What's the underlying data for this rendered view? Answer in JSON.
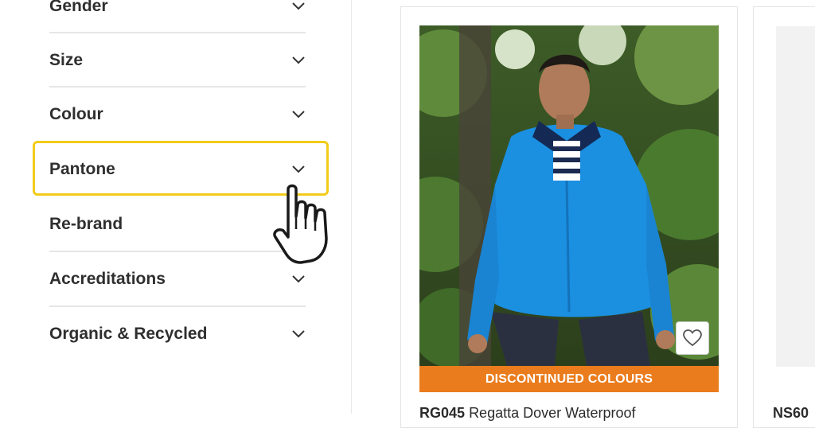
{
  "filters": {
    "items": [
      {
        "label": "Gender"
      },
      {
        "label": "Size"
      },
      {
        "label": "Colour"
      },
      {
        "label": "Pantone"
      },
      {
        "label": "Re-brand"
      },
      {
        "label": "Accreditations"
      },
      {
        "label": "Organic & Recycled"
      }
    ],
    "highlighted": "Pantone"
  },
  "products": [
    {
      "code": "RG045",
      "name": "Regatta Dover Waterproof",
      "banner": "DISCONTINUED COLOURS",
      "favourite_icon": "heart-icon"
    },
    {
      "code": "NS60"
    }
  ],
  "icons": {
    "chevron": "chevron-down-icon",
    "cursor": "hand-pointer-icon"
  },
  "colors": {
    "highlight": "#f2cc1a",
    "banner": "#ea7c1d",
    "jacket": "#1b8fe0"
  }
}
